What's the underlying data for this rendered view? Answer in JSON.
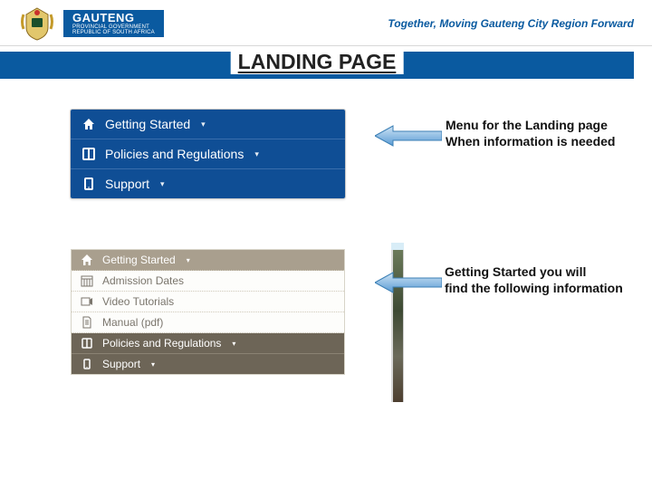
{
  "header": {
    "brand_top": "GAUTENG",
    "brand_mid": "PROVINCIAL GOVERNMENT",
    "brand_bot": "REPUBLIC OF SOUTH AFRICA",
    "tagline": "Together, Moving Gauteng City Region Forward"
  },
  "title": "LANDING PAGE",
  "menu_primary": {
    "items": [
      {
        "label": "Getting Started",
        "icon": "home-icon"
      },
      {
        "label": "Policies and Regulations",
        "icon": "book-icon"
      },
      {
        "label": "Support",
        "icon": "device-icon"
      }
    ]
  },
  "menu_expanded": {
    "header": {
      "label": "Getting Started",
      "icon": "home-icon"
    },
    "subitems": [
      {
        "label": "Admission Dates",
        "icon": "calendar-icon"
      },
      {
        "label": "Video Tutorials",
        "icon": "video-icon"
      },
      {
        "label": "Manual (pdf)",
        "icon": "document-icon"
      }
    ],
    "footer": [
      {
        "label": "Policies and Regulations",
        "icon": "book-icon"
      },
      {
        "label": "Support",
        "icon": "device-icon"
      }
    ]
  },
  "annotations": {
    "a1_line1": "Menu for the Landing page",
    "a1_line2": "When information is needed",
    "a2_line1": "Getting Started you will",
    "a2_line2": "find the following information"
  },
  "icons": {
    "caret": "▾"
  }
}
